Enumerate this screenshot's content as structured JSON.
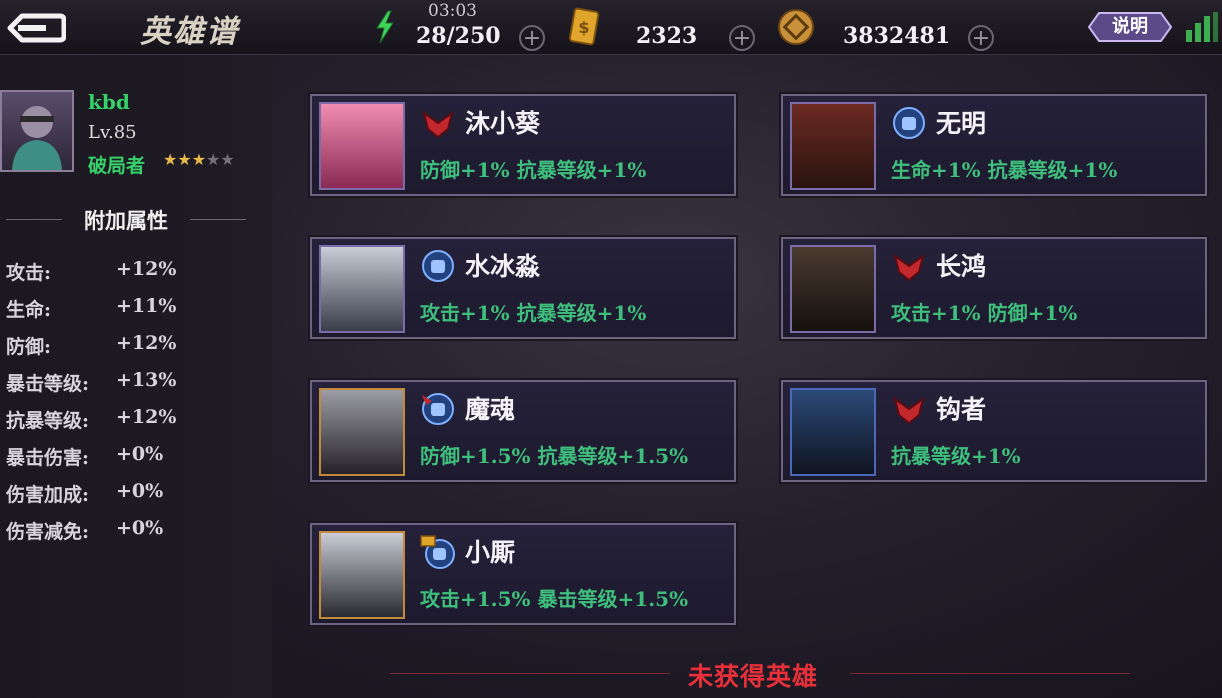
{
  "header": {
    "title": "英雄谱",
    "explain_label": "说明"
  },
  "resources": {
    "stamina": {
      "icon": "lightning-icon",
      "timer": "03:03",
      "value": "28/250"
    },
    "gold_card": {
      "icon": "gold-card-icon",
      "value": "2323"
    },
    "coins": {
      "icon": "coin-icon",
      "value": "3832481"
    }
  },
  "player": {
    "name": "kbd",
    "level": "Lv.85",
    "rank": "破局者",
    "stars_filled": 3,
    "stars_total": 5
  },
  "bonus_section": {
    "title": "附加属性",
    "stats": [
      {
        "label": "攻击:",
        "value": "+12%"
      },
      {
        "label": "生命:",
        "value": "+11%"
      },
      {
        "label": "防御:",
        "value": "+12%"
      },
      {
        "label": "暴击等级:",
        "value": "+13%"
      },
      {
        "label": "抗暴等级:",
        "value": "+12%"
      },
      {
        "label": "暴击伤害:",
        "value": "+0%"
      },
      {
        "label": "伤害加成:",
        "value": "+0%"
      },
      {
        "label": "伤害减免:",
        "value": "+0%"
      }
    ]
  },
  "heroes": [
    {
      "name": "沐小葵",
      "bonus": "防御+1%  抗暴等级+1%",
      "icon": "red-faction-icon"
    },
    {
      "name": "无明",
      "bonus": "生命+1%  抗暴等级+1%",
      "icon": "blue-fist-icon"
    },
    {
      "name": "水冰淼",
      "bonus": "攻击+1%  抗暴等级+1%",
      "icon": "blue-fist-icon"
    },
    {
      "name": "长鸿",
      "bonus": "攻击+1%  防御+1%",
      "icon": "red-faction-icon"
    },
    {
      "name": "魔魂",
      "bonus": "防御+1.5%  抗暴等级+1.5%",
      "icon": "blue-red-fist-icon"
    },
    {
      "name": "钩者",
      "bonus": "抗暴等级+1%",
      "icon": "red-faction-icon"
    },
    {
      "name": "小厮",
      "bonus": "攻击+1.5%  暴击等级+1.5%",
      "icon": "gold-blue-fist-icon"
    }
  ],
  "footer": {
    "label": "未获得英雄"
  },
  "colors": {
    "accent_green": "#3fbf7c",
    "name_green": "#37d169",
    "footer_red": "#e8303a"
  }
}
